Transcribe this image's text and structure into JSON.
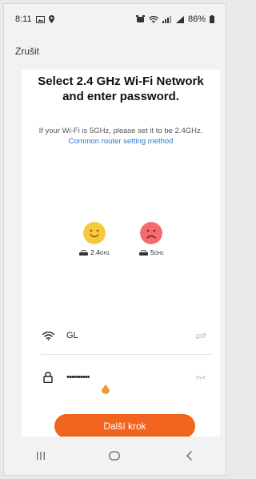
{
  "status_bar": {
    "time": "8:11",
    "battery": "86%",
    "left_icons": [
      "gallery-icon",
      "location-icon"
    ],
    "right_icons": [
      "alarm-icon",
      "wifi-icon",
      "lte-signal-icon",
      "signal-icon",
      "battery-icon"
    ]
  },
  "header": {
    "cancel_label": "Zrušit"
  },
  "main": {
    "title": "Select 2.4 GHz Wi-Fi Network and enter password.",
    "subtitle_text": "If your Wi-Fi is 5GHz, please set it to be 2.4GHz.",
    "subtitle_link": "Common router setting method",
    "bands": [
      {
        "label": "2.4",
        "unit": "GHz",
        "face": "happy",
        "color": "#f6c93a"
      },
      {
        "label": "5",
        "unit": "GHz",
        "face": "sad",
        "color": "#f56b6b"
      }
    ],
    "wifi_field": {
      "value": "GL",
      "icon": "wifi-icon",
      "action_icon": "switch-network-icon"
    },
    "password_field": {
      "value": "••••••••••",
      "icon": "lock-icon",
      "action_icon": "hide-password-icon"
    },
    "next_button_label": "Další krok"
  },
  "colors": {
    "accent": "#f0641e",
    "link": "#2a78d0",
    "happy_face": "#f6c93a",
    "sad_face": "#f56b6b"
  },
  "nav_bar": [
    "recents-icon",
    "home-icon",
    "back-icon"
  ]
}
